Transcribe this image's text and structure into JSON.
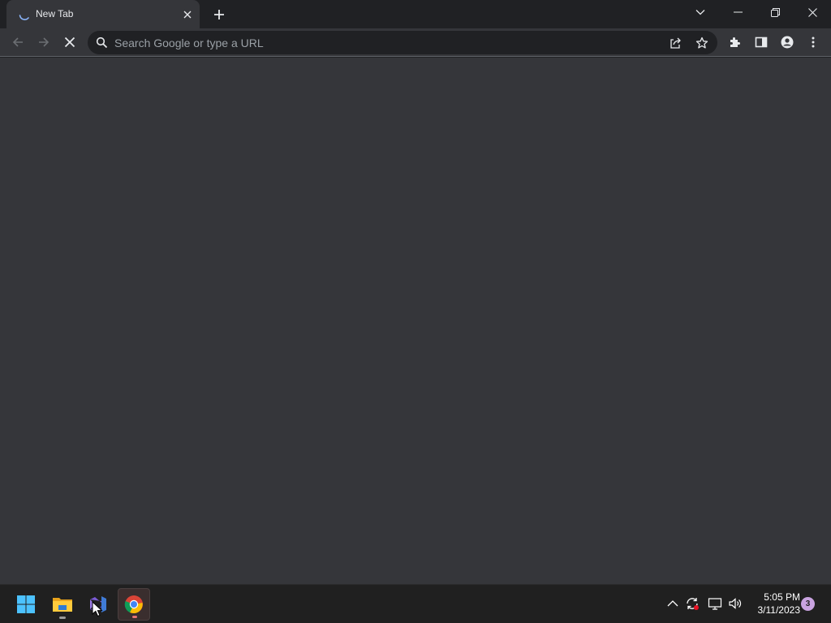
{
  "browser": {
    "tab": {
      "title": "New Tab"
    },
    "omnibox": {
      "placeholder": "Search Google or type a URL"
    }
  },
  "taskbar": {
    "clock_time": "5:05 PM",
    "clock_date": "3/11/2023",
    "notification_count": "3"
  },
  "colors": {
    "tabstrip_bg": "#202124",
    "toolbar_bg": "#35363a",
    "content_bg": "#35363a",
    "taskbar_bg": "#202020",
    "notification_badge": "#c9a3e0"
  }
}
